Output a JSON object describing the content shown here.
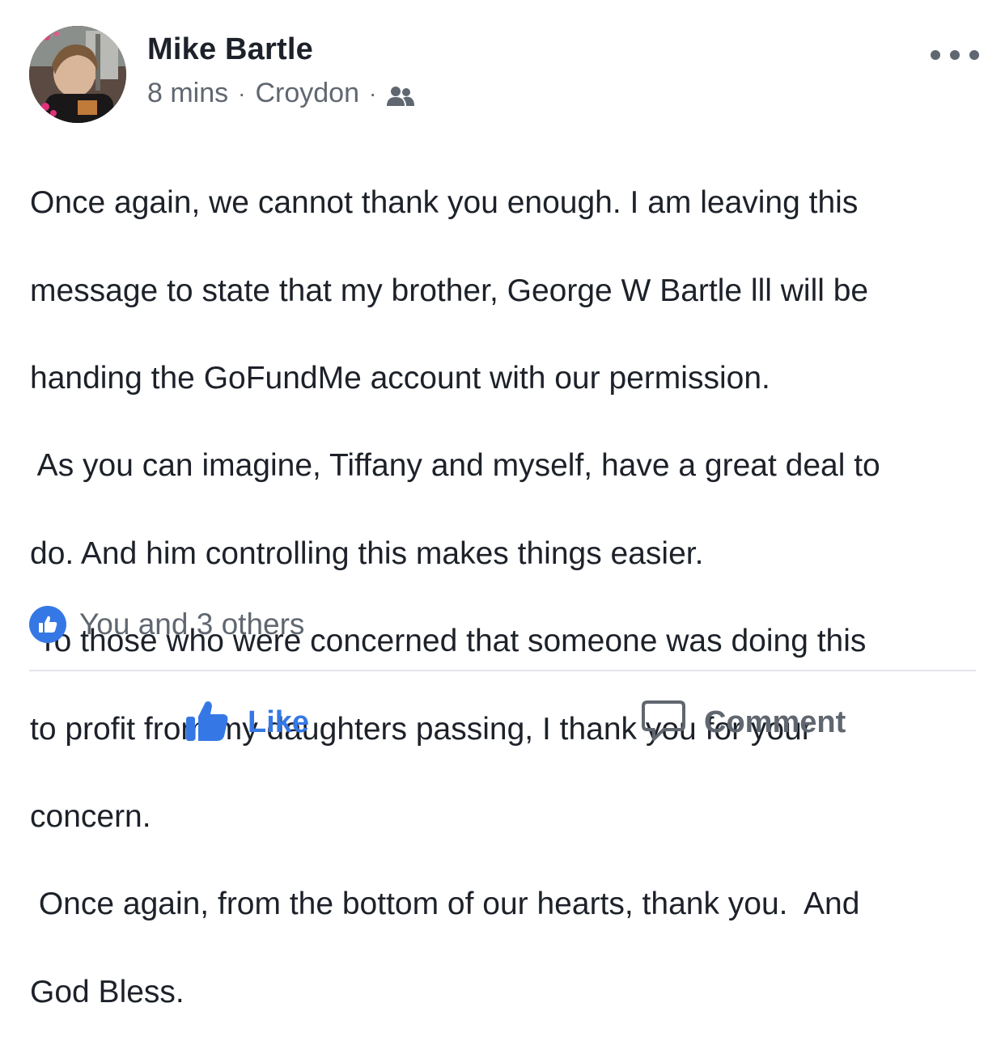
{
  "post": {
    "author": "Mike Bartle",
    "time": "8 mins",
    "location": "Croydon",
    "separator": "·",
    "audience_icon": "friends-icon",
    "text_lines": [
      "Once again, we cannot thank you enough. I am leaving this",
      "message to state that my brother, George W Bartle lll will be",
      "handing the GoFundMe account with our permission.",
      " As you can imagine, Tiffany and myself, have a great deal to",
      "do. And him controlling this makes things easier.",
      " To those who were concerned that someone was doing this",
      "to profit from my daughters passing, I thank you for your",
      "concern.",
      " Once again, from the bottom of our hearts, thank you.  And",
      "God Bless."
    ],
    "reactions_text": "You and 3 others"
  },
  "actions": {
    "like_label": "Like",
    "comment_label": "Comment"
  },
  "colors": {
    "accent": "#3578e5",
    "text": "#1d2129",
    "secondary": "#606770",
    "divider": "#e4e6eb"
  }
}
